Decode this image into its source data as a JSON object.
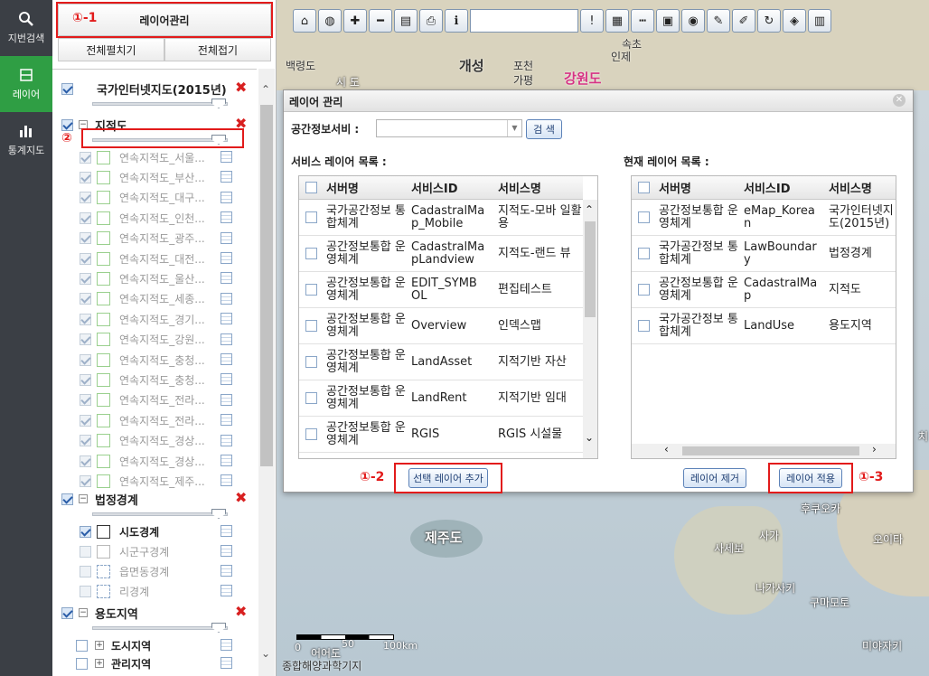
{
  "nav": {
    "items": [
      {
        "label": "지번검색",
        "icon": "search-icon"
      },
      {
        "label": "레이어",
        "icon": "layer-icon",
        "active": true
      },
      {
        "label": "통계지도",
        "icon": "bar-chart-icon"
      }
    ]
  },
  "panel": {
    "layer_manage_button": "레이어관리",
    "expand_all": "전체펼치기",
    "collapse_all": "전체접기",
    "groups": [
      {
        "title": "국가인터넷지도(2015년)"
      },
      {
        "title": "지적도"
      },
      {
        "title": "법정경계"
      },
      {
        "title": "용도지역"
      }
    ],
    "cadastral_children": [
      "연속지적도_서울...",
      "연속지적도_부산...",
      "연속지적도_대구...",
      "연속지적도_인천...",
      "연속지적도_광주...",
      "연속지적도_대전...",
      "연속지적도_울산...",
      "연속지적도_세종...",
      "연속지적도_경기...",
      "연속지적도_강원...",
      "연속지적도_충청...",
      "연속지적도_충청...",
      "연속지적도_전라...",
      "연속지적도_전라...",
      "연속지적도_경상...",
      "연속지적도_경상...",
      "연속지적도_제주..."
    ],
    "boundary_children": [
      "시도경계",
      "시군구경계",
      "읍면동경계",
      "리경계"
    ],
    "landuse_children": [
      "도시지역",
      "관리지역"
    ]
  },
  "annotations": {
    "a1": "①-1",
    "a2": "②",
    "a3": "①-2",
    "a4": "①-3"
  },
  "map": {
    "labels": [
      "백령도",
      "개성",
      "포천",
      "가평",
      "강원도",
      "속초",
      "인제",
      "시 도",
      "제주도",
      "후쿠오카",
      "사가",
      "사세보",
      "오이타",
      "나가사키",
      "구마모토",
      "미야자키",
      "어어도"
    ],
    "scale": {
      "zero": "0",
      "mid": "50",
      "end": "100km"
    },
    "credit": "종합해양과학기지",
    "right_edge_char": "치"
  },
  "modal": {
    "title": "레이어 관리",
    "server_label": "공간정보서비 :",
    "server_value": "",
    "search_button": "검 색",
    "service_list_label": "서비스 레이어 목록 :",
    "current_list_label": "현재 레이어 목록 :",
    "service_columns": [
      "서버명",
      "서비스ID",
      "서비스명"
    ],
    "service_rows": [
      {
        "server": "국가공간정보 통합체계",
        "id": "CadastralMa p_Mobile",
        "name": "지적도-모바 일활용"
      },
      {
        "server": "공간정보통합 운영체계",
        "id": "CadastralMa pLandview",
        "name": "지적도-랜드 뷰"
      },
      {
        "server": "공간정보통합 운영체계",
        "id": "EDIT_SYMB OL",
        "name": "편집테스트"
      },
      {
        "server": "공간정보통합 운영체계",
        "id": "Overview",
        "name": "인덱스맵"
      },
      {
        "server": "공간정보통합 운영체계",
        "id": "LandAsset",
        "name": "지적기반 자산"
      },
      {
        "server": "공간정보통합 운영체계",
        "id": "LandRent",
        "name": "지적기반 임대"
      },
      {
        "server": "공간정보통합 운영체계",
        "id": "RGIS",
        "name": "RGIS 시설물"
      }
    ],
    "current_columns": [
      "서버명",
      "서비스ID",
      "서비스명"
    ],
    "current_rows": [
      {
        "server": "공간정보통합 운영체계",
        "id": "eMap_Korea n",
        "name": "국가인터넷지 도(2015년)"
      },
      {
        "server": "국가공간정보 통합체계",
        "id": "LawBoundar y",
        "name": "법정경계"
      },
      {
        "server": "공간정보통합 운영체계",
        "id": "CadastralMa p",
        "name": "지적도"
      },
      {
        "server": "국가공간정보 통합체계",
        "id": "LandUse",
        "name": "용도지역"
      }
    ],
    "add_selected_button": "선택 레이어 추가",
    "remove_layer_button": "레이어 제거",
    "apply_layer_button": "레이어 적용"
  },
  "colors": {
    "nav_bg": "#3b3f45",
    "nav_active": "#2f9e44",
    "highlight_red": "#e21b1b",
    "button_blue": "#5c82b8"
  }
}
